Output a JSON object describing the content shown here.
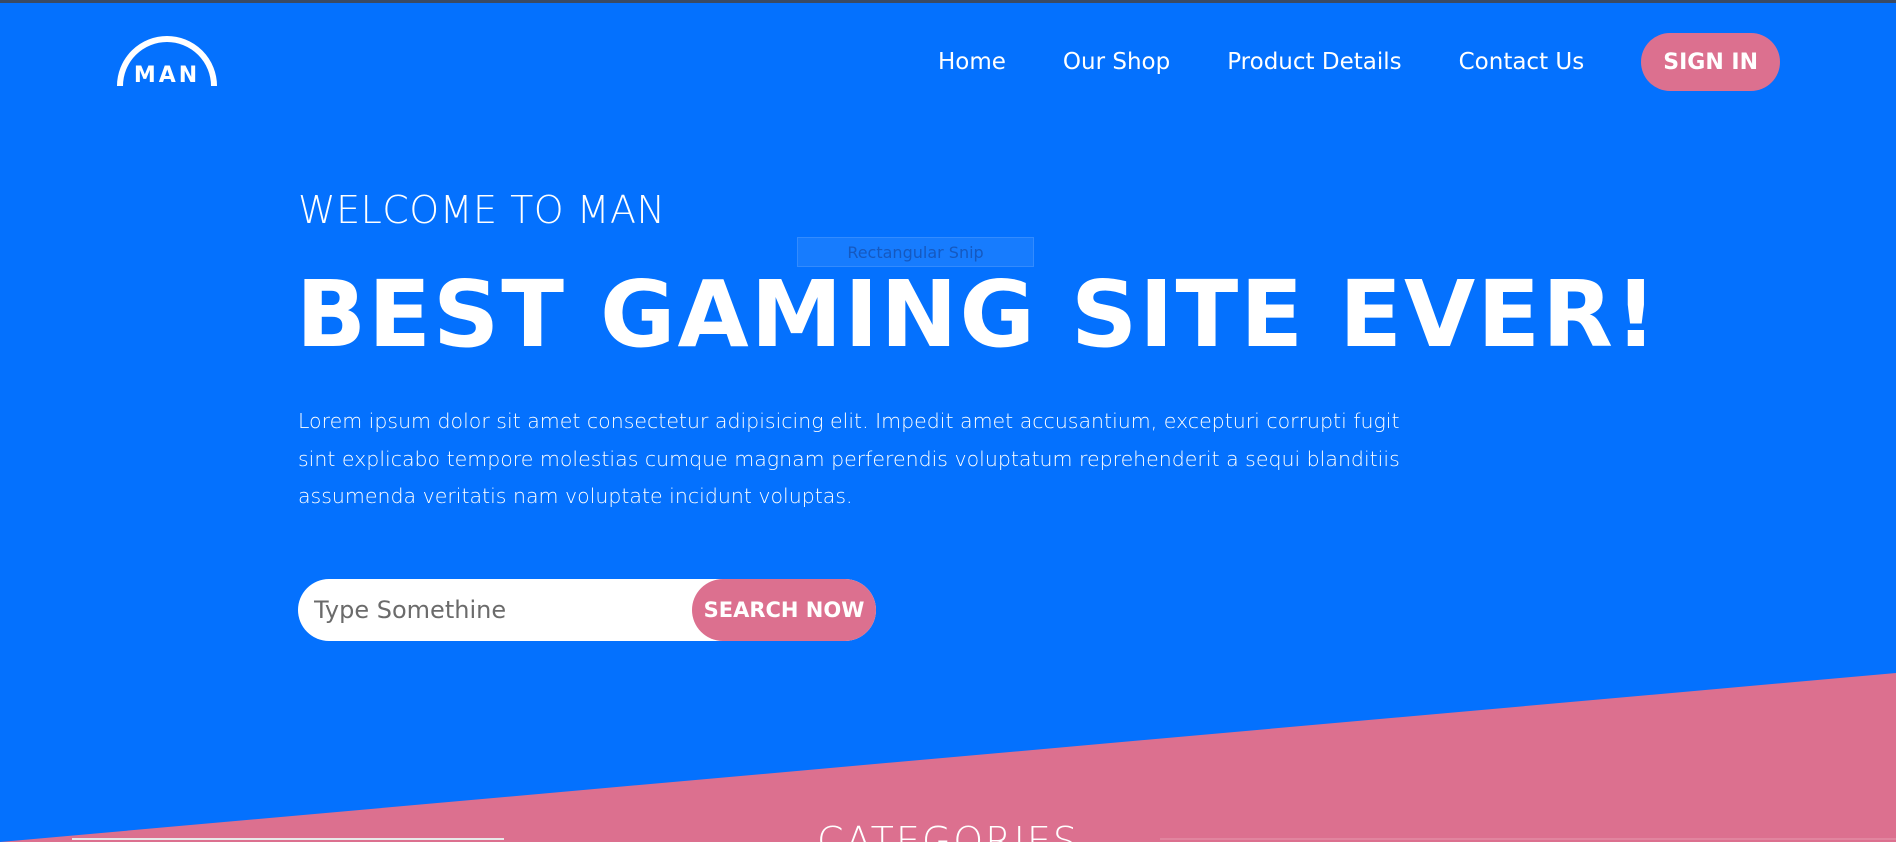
{
  "header": {
    "logo_text": "MAN",
    "nav": [
      {
        "label": "Home"
      },
      {
        "label": "Our Shop"
      },
      {
        "label": "Product Details"
      },
      {
        "label": "Contact Us"
      }
    ],
    "sign_in_label": "SIGN IN"
  },
  "hero": {
    "welcome": "WELCOME TO MAN",
    "headline": "BEST GAMING SITE EVER!",
    "intro": "Lorem ipsum dolor sit amet consectetur adipisicing elit. Impedit amet accusantium, excepturi corrupti fugit sint explicabo tempore molestias cumque magnam perferendis voluptatum reprehenderit a sequi blanditiis assumenda veritatis nam voluptate incidunt voluptas.",
    "search": {
      "placeholder": "Type Somethine",
      "button_label": "SEARCH NOW"
    }
  },
  "overlay": {
    "snip_tooltip": "Rectangular Snip"
  },
  "categories": {
    "heading": "CATEGORIES"
  },
  "colors": {
    "background": "#0471fe",
    "accent": "#dc708f",
    "text": "#ffffff"
  }
}
